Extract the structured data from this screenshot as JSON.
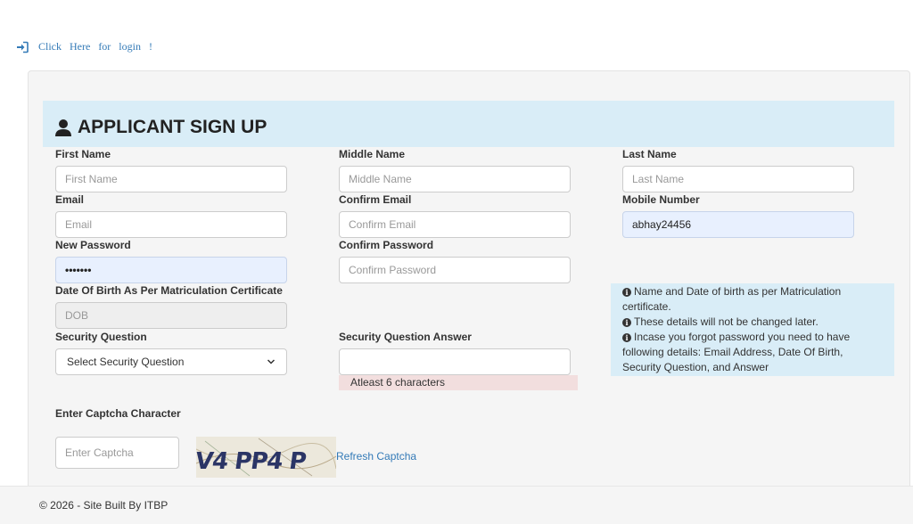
{
  "login_link": {
    "text": "Click Here for login !",
    "icon": "sign-in-icon"
  },
  "heading": {
    "title": "APPLICANT SIGN UP",
    "icon": "user-icon"
  },
  "fields": {
    "first_name": {
      "label": "First Name",
      "placeholder": "First Name",
      "value": ""
    },
    "middle_name": {
      "label": "Middle Name",
      "placeholder": "Middle Name",
      "value": ""
    },
    "last_name": {
      "label": "Last Name",
      "placeholder": "Last Name",
      "value": ""
    },
    "email": {
      "label": "Email",
      "placeholder": "Email",
      "value": ""
    },
    "confirm_email": {
      "label": "Confirm Email",
      "placeholder": "Confirm Email",
      "value": ""
    },
    "mobile": {
      "label": "Mobile Number",
      "placeholder": "Mobile Number",
      "value": "abhay24456"
    },
    "new_password": {
      "label": "New Password",
      "placeholder": "New Password",
      "value": "•••••••"
    },
    "confirm_password": {
      "label": "Confirm Password",
      "placeholder": "Confirm Password",
      "value": ""
    },
    "dob": {
      "label": "Date Of Birth As Per Matriculation Certificate",
      "placeholder": "DOB",
      "value": ""
    },
    "security_question": {
      "label": "Security Question",
      "selected": "Select Security Question"
    },
    "security_answer": {
      "label": "Security Question Answer",
      "value": "",
      "hint": "Atleast 6 characters"
    },
    "captcha": {
      "label": "Enter Captcha Character",
      "placeholder": "Enter Captcha",
      "value": "",
      "image_text": "V4 PP4 P",
      "refresh": "Refresh Captcha"
    }
  },
  "notes": [
    "Name and Date of birth as per Matriculation certificate.",
    "These details will not be changed later.",
    "Incase you forgot password you need to have following details: Email Address, Date Of Birth, Security Question, and Answer"
  ],
  "footer": {
    "text": "© 2026 - Site Built By ITBP"
  },
  "colors": {
    "link": "#337ab7",
    "heading_bg": "#d9edf7",
    "hint_bg": "#f2dede",
    "well_bg": "#f5f5f5"
  }
}
